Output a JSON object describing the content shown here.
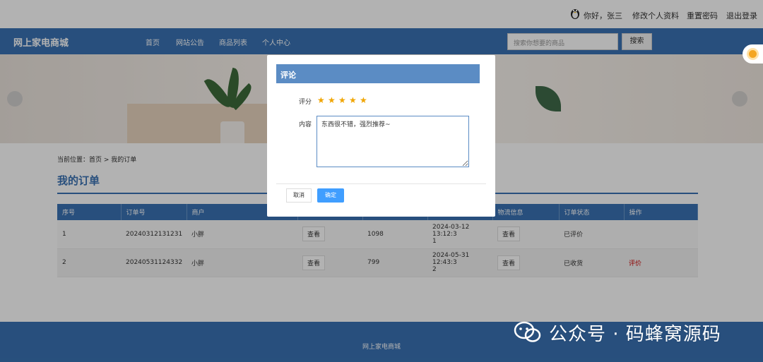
{
  "topbar": {
    "greeting": "你好，张三",
    "links": [
      "修改个人资料",
      "重置密码",
      "退出登录"
    ]
  },
  "nav": {
    "brand": "网上家电商城",
    "menu": [
      "首页",
      "网站公告",
      "商品列表",
      "个人中心"
    ],
    "search_placeholder": "搜索你想要的商品",
    "search_button": "搜索"
  },
  "breadcrumb": "当前位置：首页 > 我的订单",
  "page_title": "我的订单",
  "orders": {
    "headers": [
      "序号",
      "订单号",
      "商户",
      "",
      "",
      "",
      "物流信息",
      "订单状态",
      "操作"
    ],
    "rows": [
      {
        "no": "1",
        "order_id": "20240312131231",
        "merchant": "小胖",
        "view_label": "查看",
        "amount": "1098",
        "time_a": "2024-03-12 13:12:3",
        "time_b": "1",
        "logistics_label": "查看",
        "status": "已评价",
        "action": ""
      },
      {
        "no": "2",
        "order_id": "20240531124332",
        "merchant": "小胖",
        "view_label": "查看",
        "amount": "799",
        "time_a": "2024-05-31 12:43:3",
        "time_b": "2",
        "logistics_label": "查看",
        "status": "已收货",
        "action": "评价"
      }
    ]
  },
  "footer": "网上家电商城",
  "modal": {
    "title": "评论",
    "score_label": "评分",
    "rating": 5,
    "content_label": "内容",
    "content_value": "东西很不错，强烈推荐~",
    "cancel": "取消",
    "ok": "确定"
  },
  "watermark": "公众号 · 码蜂窝源码",
  "colors": {
    "primary": "#3a72b3",
    "modal_header": "#5b8cc4",
    "ok_button": "#409eff",
    "star": "#f0a500",
    "action": "#cc0000"
  }
}
